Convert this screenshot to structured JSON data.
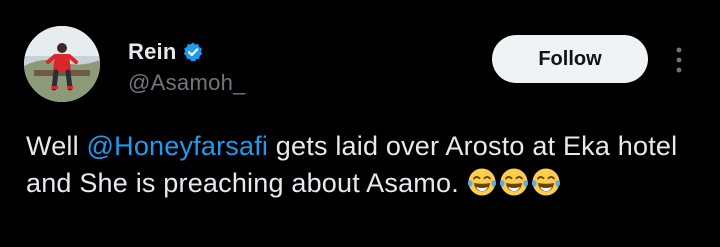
{
  "author": {
    "display_name": "Rein",
    "handle": "@Asamoh_",
    "verified": true
  },
  "actions": {
    "follow_label": "Follow"
  },
  "post": {
    "text_before": "Well ",
    "mention": "@Honeyfarsafi",
    "text_after": " gets laid over Arosto at Eka hotel and She is preaching about Asamo. ",
    "emoji": "face-with-tears-of-joy-icon",
    "emoji_count": 3
  },
  "colors": {
    "background": "#000000",
    "text_primary": "#e7e9ea",
    "text_secondary": "#71767b",
    "accent": "#1d9bf0",
    "follow_bg": "#eff3f4",
    "follow_text": "#0f1419"
  }
}
